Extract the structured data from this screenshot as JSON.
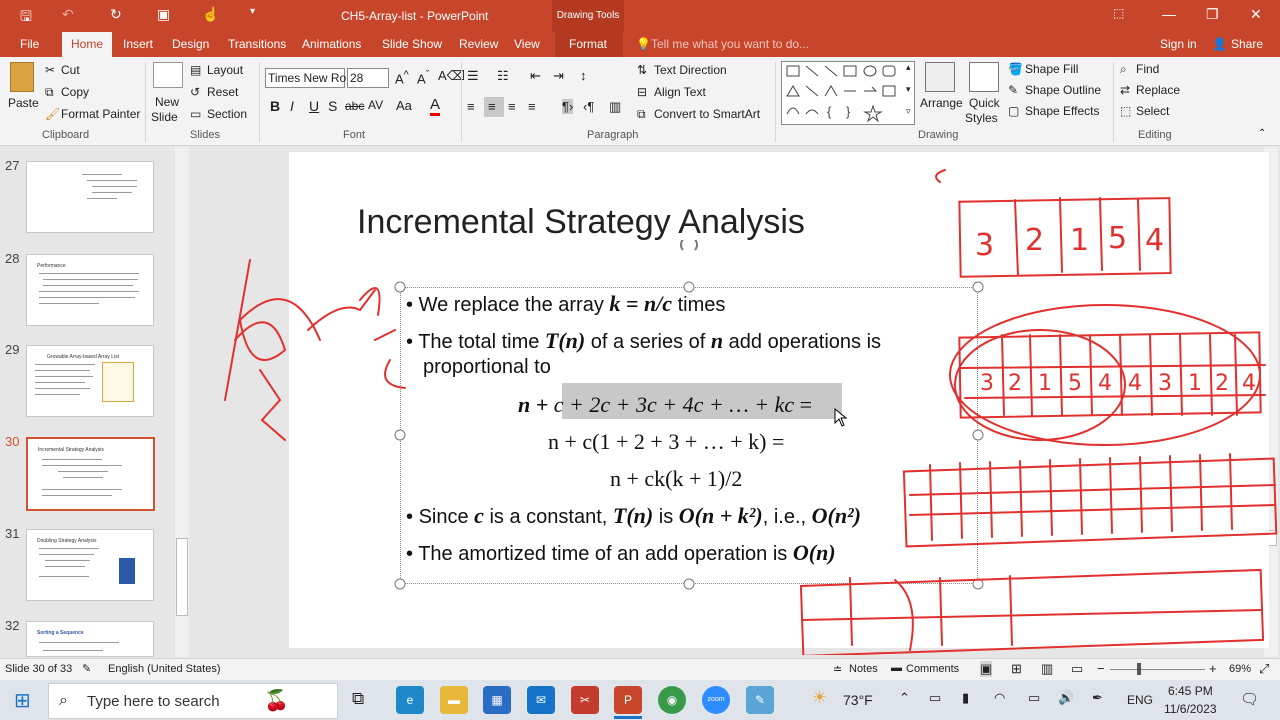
{
  "app": {
    "doc_title": "CH5-Array-list - PowerPoint",
    "drawing_tools": "Drawing Tools",
    "signin": "Sign in",
    "share": "Share",
    "tell_me": "Tell me what you want to do..."
  },
  "tabs": [
    "File",
    "Home",
    "Insert",
    "Design",
    "Transitions",
    "Animations",
    "Slide Show",
    "Review",
    "View",
    "Format"
  ],
  "ribbon": {
    "clipboard": {
      "paste": "Paste",
      "cut": "Cut",
      "copy": "Copy",
      "format_painter": "Format Painter",
      "label": "Clipboard"
    },
    "slides": {
      "new_slide": "New",
      "new_slide2": "Slide",
      "layout": "Layout",
      "reset": "Reset",
      "section": "Section",
      "label": "Slides"
    },
    "font": {
      "family": "Times New Ro",
      "size": "28",
      "label": "Font"
    },
    "paragraph": {
      "text_direction": "Text Direction",
      "align_text": "Align Text",
      "smartart": "Convert to SmartArt",
      "label": "Paragraph"
    },
    "drawing": {
      "arrange": "Arrange",
      "quick": "Quick",
      "styles": "Styles",
      "shape_fill": "Shape Fill",
      "shape_outline": "Shape Outline",
      "shape_effects": "Shape Effects",
      "label": "Drawing"
    },
    "editing": {
      "find": "Find",
      "replace": "Replace",
      "select": "Select",
      "label": "Editing"
    }
  },
  "thumbnails": [
    {
      "num": "27",
      "title": ""
    },
    {
      "num": "28",
      "title": "Performance"
    },
    {
      "num": "29",
      "title": "Growable Array-based Array List"
    },
    {
      "num": "30",
      "title": "Incremental Strategy Analysis"
    },
    {
      "num": "31",
      "title": "Doubling Strategy Analysis"
    },
    {
      "num": "32",
      "title": "Sorting a Sequence"
    }
  ],
  "slide": {
    "title": "Incremental Strategy Analysis",
    "b1_pre": "We replace the array ",
    "b1_math": "k = n/c",
    "b1_post": " times",
    "b2_pre": "The total time ",
    "b2_m1": "T(n)",
    "b2_mid": " of a series of ",
    "b2_m2": "n",
    "b2_post": " add operations is",
    "b2_line2": "proportional to",
    "eq1_a": "n + ",
    "eq1_hl": "c + 2c + 3c + 4c + … + kc",
    "eq1_b": " =",
    "eq2": "n + c(1 + 2 + 3 + … + k) =",
    "eq3": "n + ck(k + 1)/2",
    "b3_pre": "Since ",
    "b3_m1": "c",
    "b3_mid": " is a constant, ",
    "b3_m2": "T(n)",
    "b3_is": " is ",
    "b3_m3": "O(n + k²)",
    "b3_ie": ", i.e., ",
    "b3_m4": "O(n²)",
    "b4_pre": "The amortized time of an add operation is ",
    "b4_m": "O(n)"
  },
  "ink": {
    "row1": [
      "3",
      "2",
      "1",
      "5",
      "4"
    ],
    "row2": [
      "3",
      "2",
      "1",
      "5",
      "4",
      "4",
      "3",
      "1",
      "2",
      "4"
    ]
  },
  "status": {
    "slide_of": "Slide 30 of 33",
    "language": "English (United States)",
    "notes": "Notes",
    "comments": "Comments",
    "zoom": "69%"
  },
  "taskbar": {
    "search": "Type here to search",
    "weather": "73°F",
    "lang": "ENG",
    "time": "6:45 PM",
    "date": "11/6/2023"
  }
}
